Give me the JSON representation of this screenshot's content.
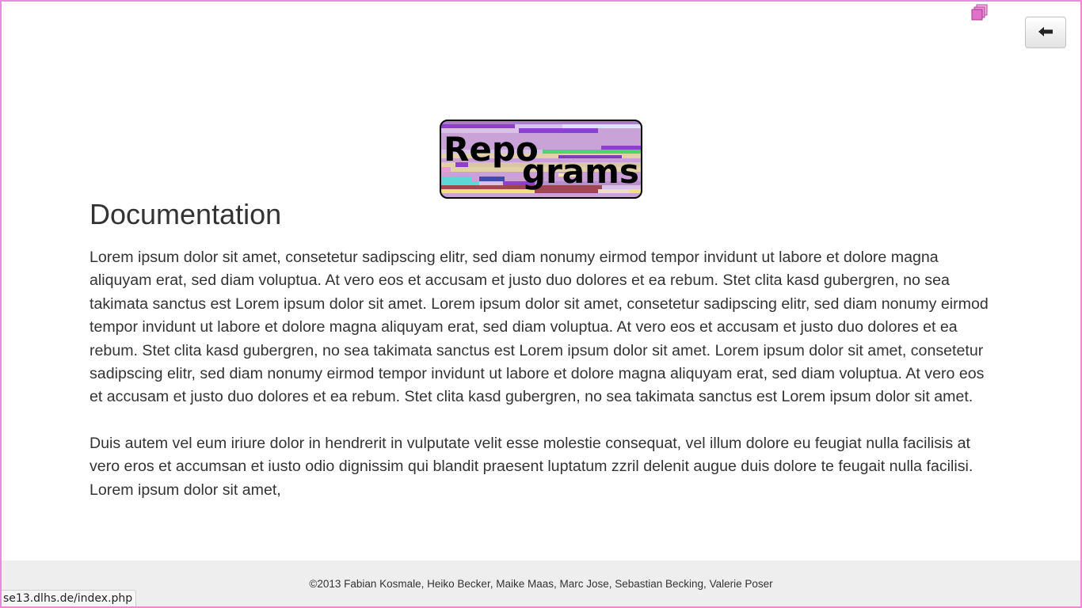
{
  "header": {
    "corner_icon": "stacked-windows-icon",
    "back_icon": "arrow-left-icon"
  },
  "logo": {
    "line1": "Repo",
    "line2": "grams"
  },
  "main": {
    "title": "Documentation",
    "paragraphs": [
      "Lorem ipsum dolor sit amet, consetetur sadipscing elitr, sed diam nonumy eirmod tempor invidunt ut labore et dolore magna aliquyam erat, sed diam voluptua. At vero eos et accusam et justo duo dolores et ea rebum. Stet clita kasd gubergren, no sea takimata sanctus est Lorem ipsum dolor sit amet. Lorem ipsum dolor sit amet, consetetur sadipscing elitr, sed diam nonumy eirmod tempor invidunt ut labore et dolore magna aliquyam erat, sed diam voluptua. At vero eos et accusam et justo duo dolores et ea rebum. Stet clita kasd gubergren, no sea takimata sanctus est Lorem ipsum dolor sit amet. Lorem ipsum dolor sit amet, consetetur sadipscing elitr, sed diam nonumy eirmod tempor invidunt ut labore et dolore magna aliquyam erat, sed diam voluptua. At vero eos et accusam et justo duo dolores et ea rebum. Stet clita kasd gubergren, no sea takimata sanctus est Lorem ipsum dolor sit amet.",
      "Duis autem vel eum iriure dolor in hendrerit in vulputate velit esse molestie consequat, vel illum dolore eu feugiat nulla facilisis at vero eros et accumsan et iusto odio dignissim qui blandit praesent luptatum zzril delenit augue duis dolore te feugait nulla facilisi. Lorem ipsum dolor sit amet,"
    ]
  },
  "footer": {
    "copyright": "©2013 Fabian Kosmale, Heiko Becker, Maike Maas, Marc Jose, Sebastian Becking, Valerie Poser"
  },
  "status_bar": {
    "url": "se13.dlhs.de/index.php"
  },
  "colors": {
    "frame": "#e98bd6",
    "text": "#333333",
    "footer_bg": "#eeeeee",
    "icon_pink": "#e070c8"
  }
}
